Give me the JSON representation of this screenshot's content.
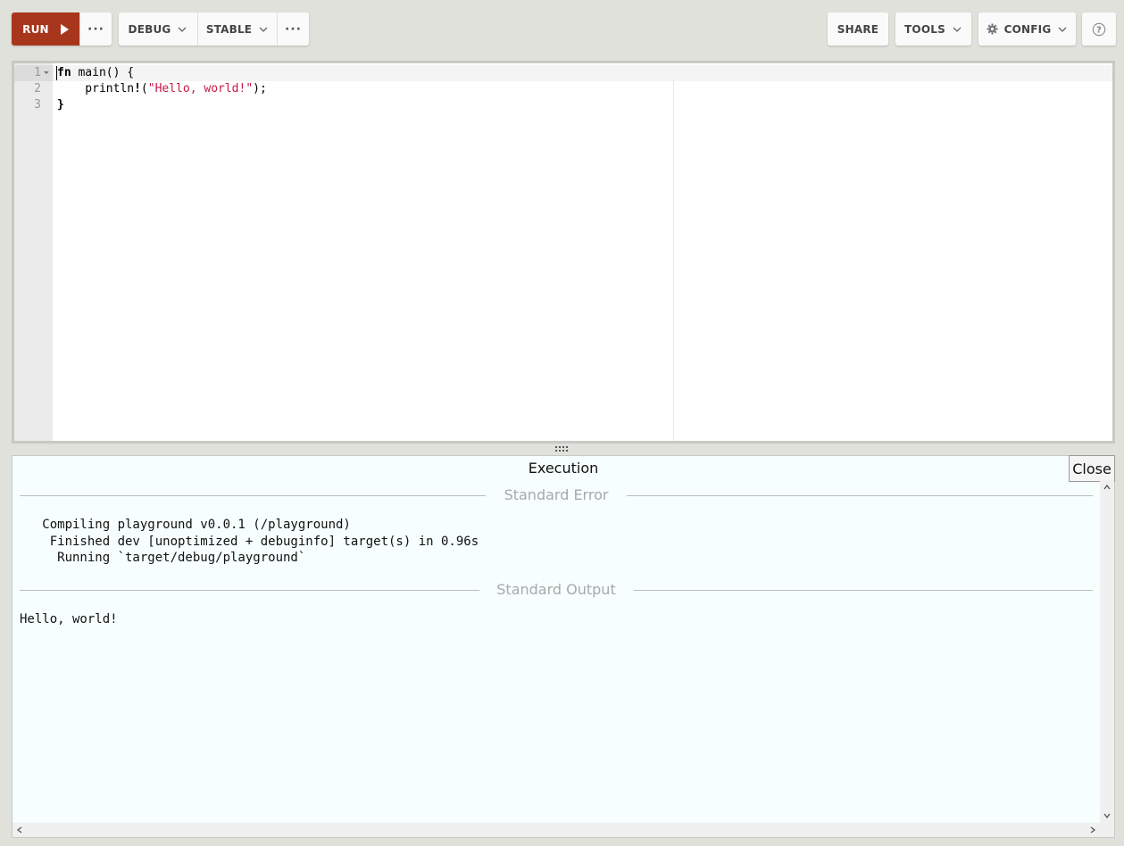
{
  "toolbar": {
    "run_label": "RUN",
    "run_more": "···",
    "mode_label": "DEBUG",
    "channel_label": "STABLE",
    "advanced_more": "···",
    "share_label": "SHARE",
    "tools_label": "TOOLS",
    "config_label": "CONFIG",
    "help_symbol": "?"
  },
  "editor": {
    "line_numbers": [
      "1",
      "2",
      "3"
    ],
    "lines": [
      {
        "kw": "fn",
        "rest": " main() {"
      },
      {
        "pre": "    println",
        "bang": "!",
        "open": "(",
        "str": "\"Hello, world!\"",
        "close": ");"
      },
      {
        "kw": "}",
        "rest": ""
      }
    ]
  },
  "output": {
    "title": "Execution",
    "close_label": "Close",
    "stderr_label": "Standard Error",
    "stderr_lines": [
      "   Compiling playground v0.0.1 (/playground)",
      "    Finished dev [unoptimized + debuginfo] target(s) in 0.96s",
      "     Running `target/debug/playground`"
    ],
    "stdout_label": "Standard Output",
    "stdout_lines": [
      "Hello, world!"
    ]
  },
  "colors": {
    "run_button": "#a8361c",
    "background": "#e1e1db",
    "output_background": "#f6fefe",
    "string_literal": "#c41a45"
  }
}
